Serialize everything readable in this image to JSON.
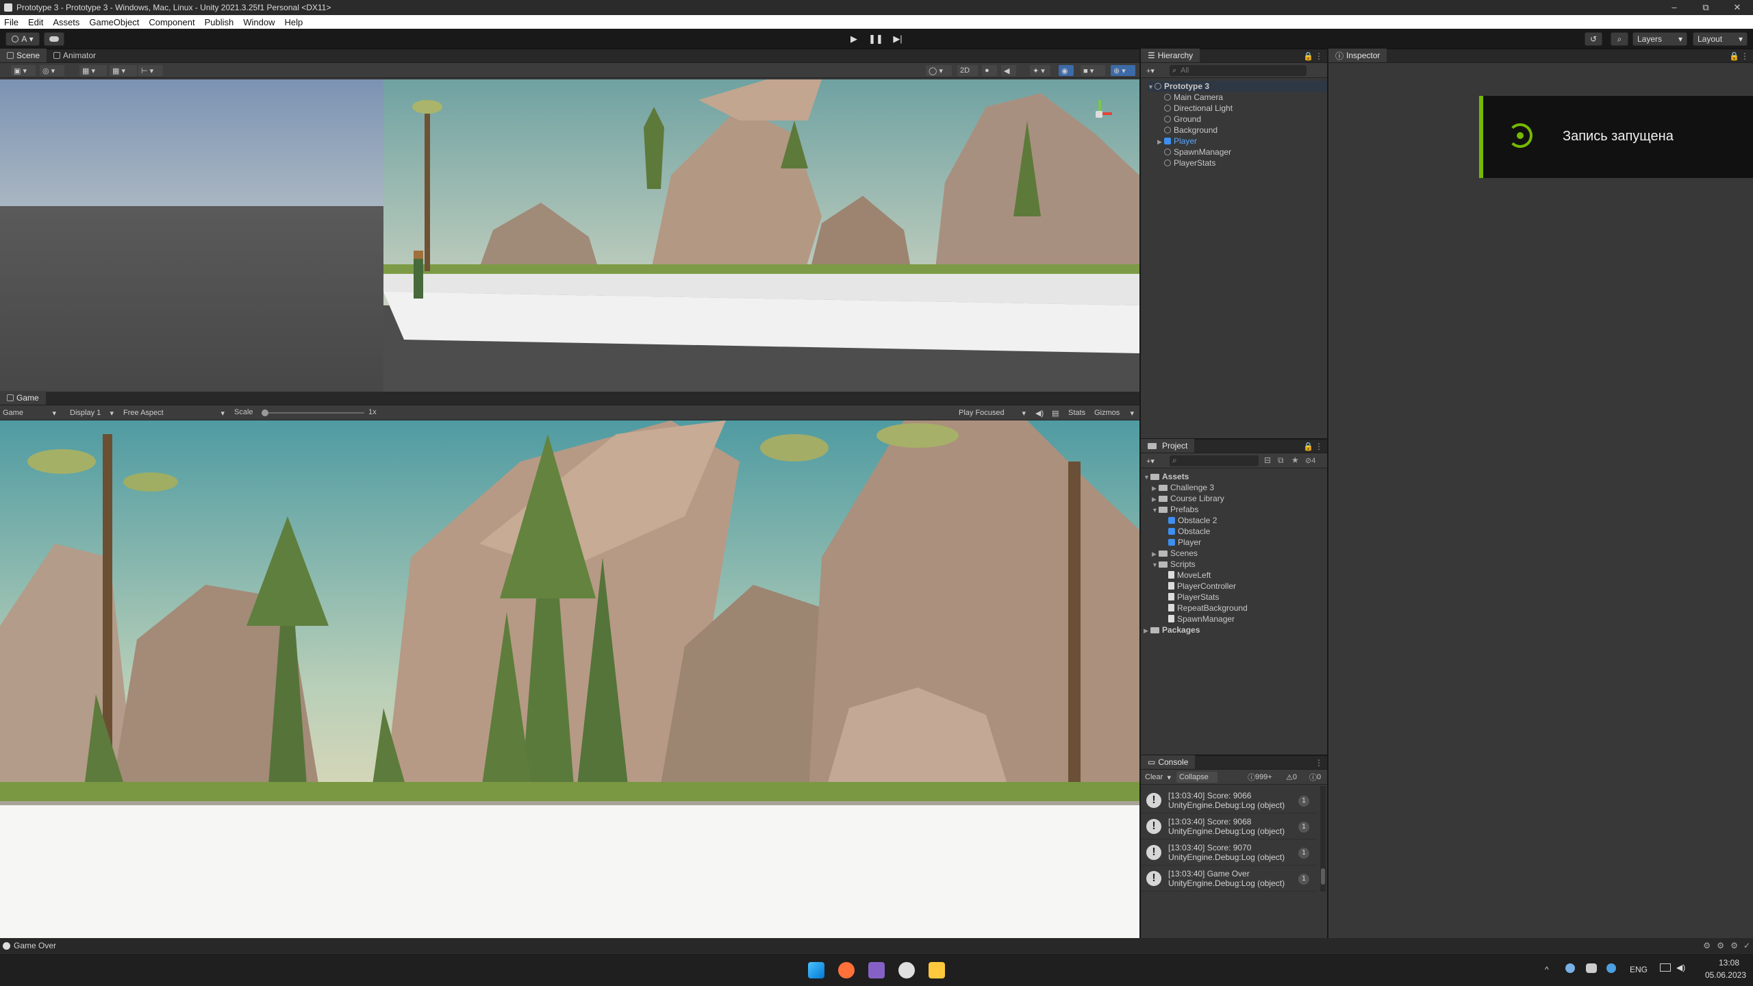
{
  "window": {
    "title": "Prototype 3 - Prototype 3 - Windows, Mac, Linux - Unity 2021.3.25f1 Personal <DX11>",
    "controls": [
      "–",
      "⧉",
      "✕"
    ]
  },
  "menu": [
    "File",
    "Edit",
    "Assets",
    "GameObject",
    "Component",
    "Publish",
    "Window",
    "Help"
  ],
  "toolbar": {
    "account": "A",
    "layers": "Layers",
    "layout": "Layout"
  },
  "scene_panel": {
    "tabs": [
      "Scene",
      "Animator"
    ],
    "mode_2d": "2D"
  },
  "game_panel": {
    "tab": "Game",
    "game_select": "Game",
    "display": "Display 1",
    "aspect": "Free Aspect",
    "scale_label": "Scale",
    "scale_value": "1x",
    "play_mode": "Play Focused",
    "stats": "Stats",
    "gizmos": "Gizmos"
  },
  "hierarchy": {
    "tab": "Hierarchy",
    "search_placeholder": "All",
    "root": "Prototype 3",
    "items": [
      "Main Camera",
      "Directional Light",
      "Ground",
      "Background",
      "Player",
      "SpawnManager",
      "PlayerStats"
    ]
  },
  "inspector": {
    "tab": "Inspector"
  },
  "recording_toast": {
    "text": "Запись запущена",
    "accent": "#76b900"
  },
  "project": {
    "tab": "Project",
    "count_badge": "4",
    "assets_label": "Assets",
    "folders": {
      "challenge": "Challenge 3",
      "course": "Course Library",
      "prefabs": "Prefabs",
      "prefab_items": [
        "Obstacle 2",
        "Obstacle",
        "Player"
      ],
      "scenes": "Scenes",
      "scripts": "Scripts",
      "script_items": [
        "MoveLeft",
        "PlayerController",
        "PlayerStats",
        "RepeatBackground",
        "SpawnManager"
      ]
    },
    "packages_label": "Packages"
  },
  "console": {
    "tab": "Console",
    "clear": "Clear",
    "collapse": "Collapse",
    "log_count": "999+",
    "warn_count": "0",
    "error_count": "0",
    "entries": [
      {
        "line1": "[13:03:40] Score: 9066",
        "line2": "UnityEngine.Debug:Log (object)",
        "count": "1"
      },
      {
        "line1": "[13:03:40] Score: 9068",
        "line2": "UnityEngine.Debug:Log (object)",
        "count": "1"
      },
      {
        "line1": "[13:03:40] Score: 9070",
        "line2": "UnityEngine.Debug:Log (object)",
        "count": "1"
      },
      {
        "line1": "[13:03:40] Game Over",
        "line2": "UnityEngine.Debug:Log (object)",
        "count": "1"
      }
    ]
  },
  "status_bar": {
    "message": "Game Over"
  },
  "taskbar": {
    "language": "ENG",
    "time": "13:08",
    "date": "05.06.2023"
  }
}
